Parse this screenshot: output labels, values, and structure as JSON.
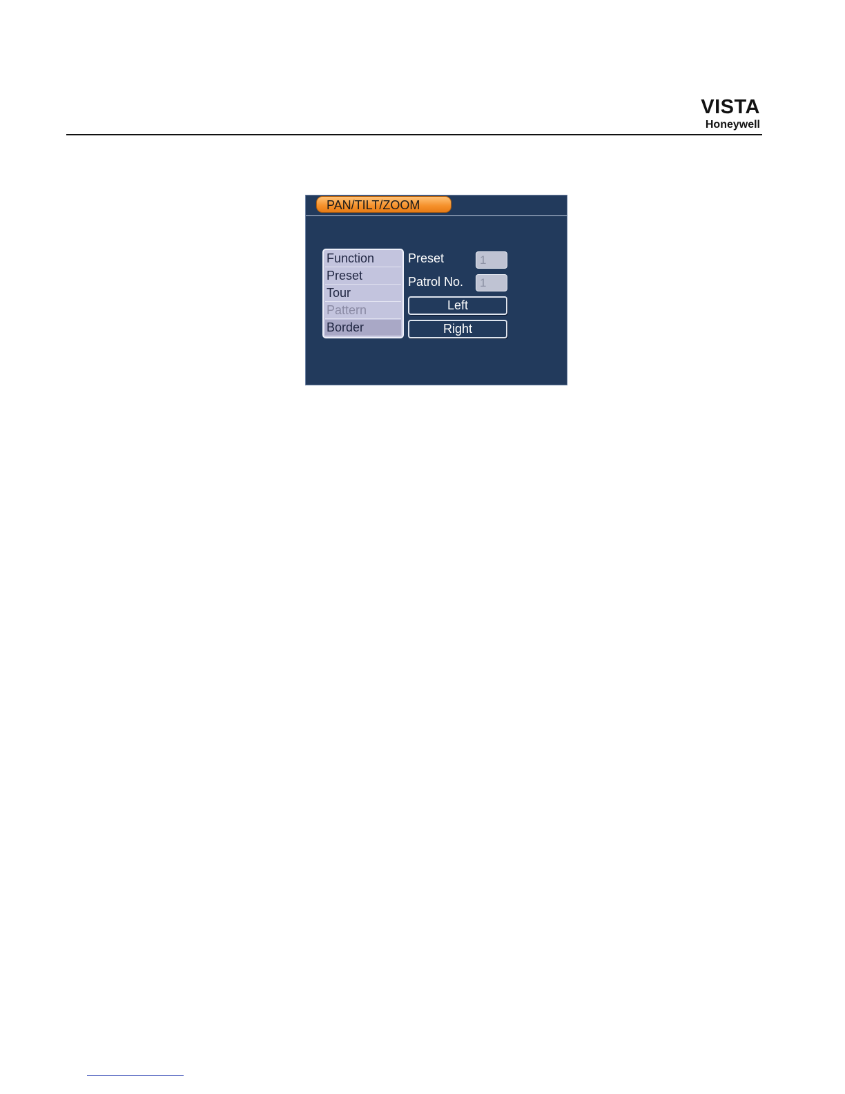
{
  "header": {
    "brand_line1": "VISTA",
    "brand_line2": "Honeywell"
  },
  "dialog": {
    "title": "PAN/TILT/ZOOM",
    "function_list": [
      {
        "label": "Function",
        "state": "normal"
      },
      {
        "label": "Preset",
        "state": "normal"
      },
      {
        "label": "Tour",
        "state": "normal"
      },
      {
        "label": "Pattern",
        "state": "disabled"
      },
      {
        "label": "Border",
        "state": "selected"
      }
    ],
    "preset_label": "Preset",
    "preset_value": "1",
    "patrol_label": "Patrol No.",
    "patrol_value": "1",
    "left_button": "Left",
    "right_button": "Right"
  },
  "colors": {
    "dialog_bg": "#223a5c",
    "title_tab": "#f5902a",
    "list_bg": "#c3c4de"
  }
}
